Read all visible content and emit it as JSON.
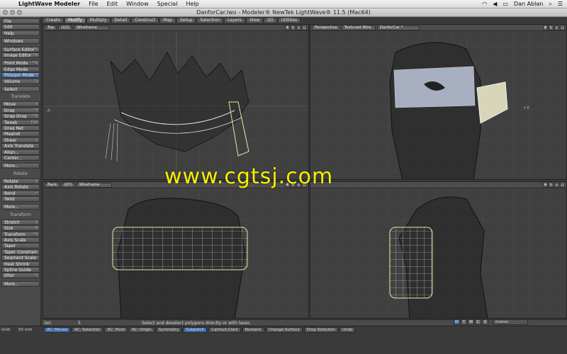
{
  "menubar": {
    "app": "LightWave Modeler",
    "items": [
      "File",
      "Edit",
      "Window",
      "Special",
      "Help"
    ],
    "user": "Dan Ablan"
  },
  "window": {
    "title": "DanforCar.lwo - Modeler® NewTek LightWave® 11.5 (Mac64)"
  },
  "tabs": [
    "Create",
    "Modify",
    "Multiply",
    "Detail",
    "Construct",
    "Map",
    "Setup",
    "Selection",
    "Layers",
    "View",
    "I/O",
    "Utilities"
  ],
  "active_tab": "Modify",
  "toolbar": {
    "top": [
      {
        "label": "File"
      },
      {
        "label": "Edit"
      },
      {
        "label": "Help"
      },
      {
        "label": "Windows"
      },
      {
        "label": "Surface Editor",
        "sc": "F5"
      },
      {
        "label": "Image Editor",
        "sc": "F6"
      },
      {
        "label": "Point Mode",
        "sc": "^G"
      },
      {
        "label": "Edge Mode",
        "sc": ""
      },
      {
        "label": "Polygon Mode",
        "sc": "^H"
      },
      {
        "label": "Volume",
        "sc": "^J"
      },
      {
        "label": "Select"
      }
    ],
    "translate_title": "Translate",
    "translate": [
      {
        "label": "Move",
        "sc": "t"
      },
      {
        "label": "Drag",
        "sc": "^T"
      },
      {
        "label": "Snap Drag",
        "sc": "^G"
      },
      {
        "label": "Tweak",
        "sc": "F10"
      },
      {
        "label": "Drag Net",
        "sc": ""
      },
      {
        "label": "Magnet",
        "sc": ""
      },
      {
        "label": "Shear",
        "sc": "["
      },
      {
        "label": "Axis Translate",
        "sc": ""
      },
      {
        "label": "Align...",
        "sc": ""
      },
      {
        "label": "Center...",
        "sc": ""
      },
      {
        "label": "More...",
        "sc": ""
      }
    ],
    "rotate_title": "Rotate",
    "rotate": [
      {
        "label": "Rotate",
        "sc": "y"
      },
      {
        "label": "Axis Rotate",
        "sc": ""
      },
      {
        "label": "Bend",
        "sc": "~"
      },
      {
        "label": "Twist",
        "sc": ""
      },
      {
        "label": "More...",
        "sc": ""
      }
    ],
    "transform_title": "Transform",
    "transform": [
      {
        "label": "Stretch",
        "sc": "h"
      },
      {
        "label": "Size",
        "sc": "H"
      },
      {
        "label": "Transform",
        "sc": "^Y"
      },
      {
        "label": "Axis Scale",
        "sc": ""
      },
      {
        "label": "Taper",
        "sc": ""
      },
      {
        "label": "Taper Constrain",
        "sc": ""
      },
      {
        "label": "Segment Scale",
        "sc": ""
      },
      {
        "label": "Heat Shrink",
        "sc": ""
      },
      {
        "label": "Spline Guide",
        "sc": ""
      },
      {
        "label": "Jitter",
        "sc": "^J"
      },
      {
        "label": "More...",
        "sc": ""
      }
    ]
  },
  "viewports": {
    "tl": {
      "view": "Top",
      "axis": "(XZ)",
      "mode": "Wireframe"
    },
    "tr": {
      "view": "Perspective",
      "mode": "Textured Wire",
      "object": "DanforCar *"
    },
    "bl": {
      "view": "Back",
      "axis": "(XY)",
      "mode": "Wireframe"
    },
    "br": {
      "view": "",
      "mode": ""
    }
  },
  "watermark": "www.cgtsj.com",
  "info": {
    "sel_label": "Sel:",
    "sel_value": "5",
    "hint": "Select and deselect polygons directly or with lasso."
  },
  "status": {
    "grid_label": "Grid:",
    "grid_value": "50 mm",
    "mouse": "AC: Mouse",
    "selection": "AC: Selection",
    "pivot": "AC: Pivot",
    "origin": "AC: Origin",
    "symmetry": "Symmetry",
    "subpatch": "Subpatch",
    "catmull": "Catmull-Clark",
    "numeric": "Numeric",
    "change_surface": "Change Surface",
    "drop_selection": "Drop Selection",
    "undo": "Undo",
    "wtmcs": [
      "W",
      "T",
      "M",
      "C",
      "S"
    ],
    "none": "(none)"
  }
}
